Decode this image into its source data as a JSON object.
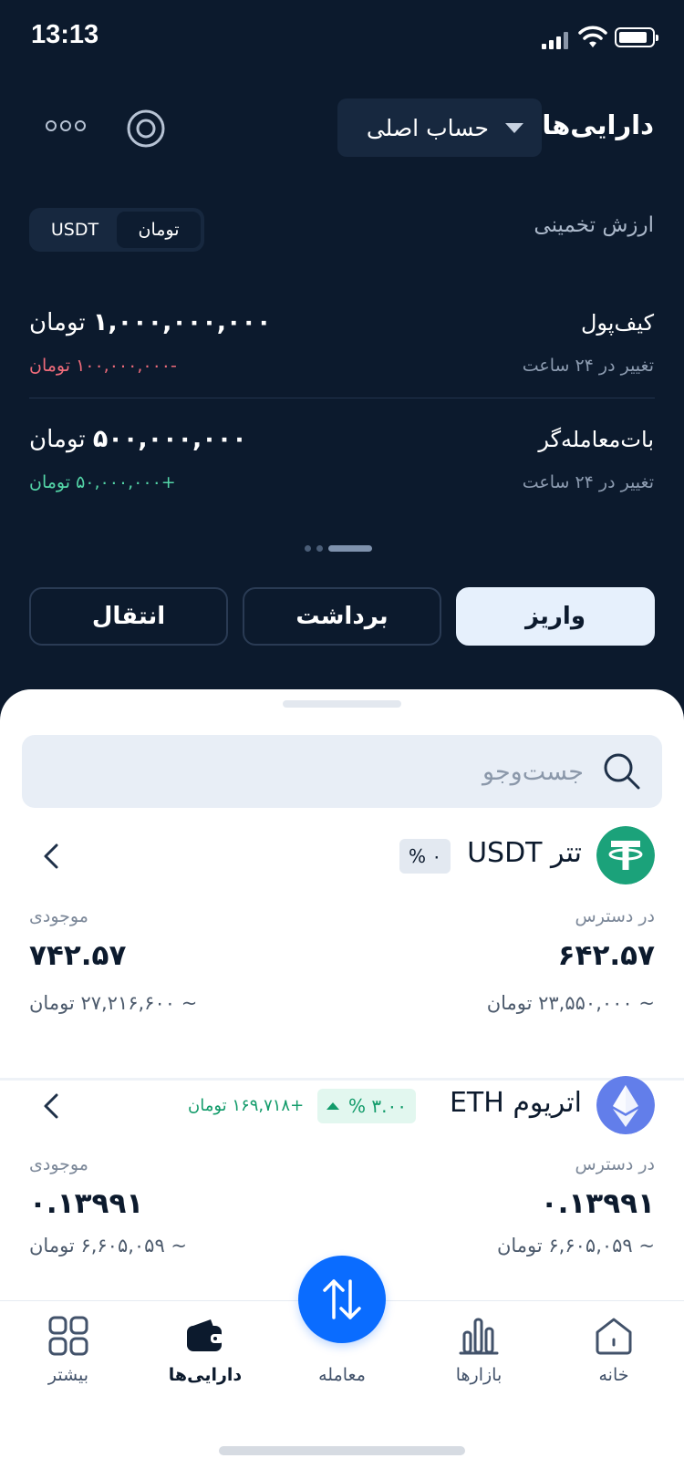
{
  "status_bar": {
    "time": "13:13"
  },
  "header": {
    "title": "دارایی‌ها",
    "account_label": "حساب اصلی"
  },
  "estimate": {
    "label": "ارزش تخمینی",
    "currencies": [
      "تومان",
      "USDT"
    ],
    "selected": "تومان"
  },
  "wallet": {
    "label": "کیف‌پول",
    "value": "۱,۰۰۰,۰۰۰,۰۰۰",
    "unit": "تومان",
    "change_label": "تغییر در ۲۴ ساعت",
    "change": "-۱۰۰,۰۰۰,۰۰۰ تومان"
  },
  "bot": {
    "label": "بات‌معامله‌گر",
    "value": "۵۰۰,۰۰۰,۰۰۰",
    "unit": "تومان",
    "change_label": "تغییر در ۲۴ ساعت",
    "change": "+۵۰,۰۰۰,۰۰۰ تومان"
  },
  "actions": {
    "deposit": "واریز",
    "withdraw": "برداشت",
    "transfer": "انتقال"
  },
  "search": {
    "placeholder": "جست‌وجو"
  },
  "assets": [
    {
      "name": "تتر USDT",
      "change_pct": "۰ %",
      "available_label": "در دسترس",
      "available": "۶۴۲.۵۷",
      "available_fiat": "~ ۲۳,۵۵۰,۰۰۰ تومان",
      "balance_label": "موجودی",
      "balance": "۷۴۲.۵۷",
      "balance_fiat": "~ ۲۷,۲۱۶,۶۰۰ تومان"
    },
    {
      "name": "اتریوم ETH",
      "change_pct": "۳.۰۰ %",
      "profit": "+۱۶۹,۷۱۸ تومان",
      "available_label": "در دسترس",
      "available": "۰.۱۳۹۹۱",
      "available_fiat": "~ ۶,۶۰۵,۰۵۹ تومان",
      "balance_label": "موجودی",
      "balance": "۰.۱۳۹۹۱",
      "balance_fiat": "~ ۶,۶۰۵,۰۵۹ تومان"
    }
  ],
  "nav": {
    "home": "خانه",
    "markets": "بازارها",
    "trade": "معامله",
    "assets": "دارایی‌ها",
    "more": "بیشتر"
  },
  "colors": {
    "background": "#0c1a2d",
    "accent": "#0a6cff",
    "positive": "#129b6a",
    "negative": "#ee6b7a"
  }
}
